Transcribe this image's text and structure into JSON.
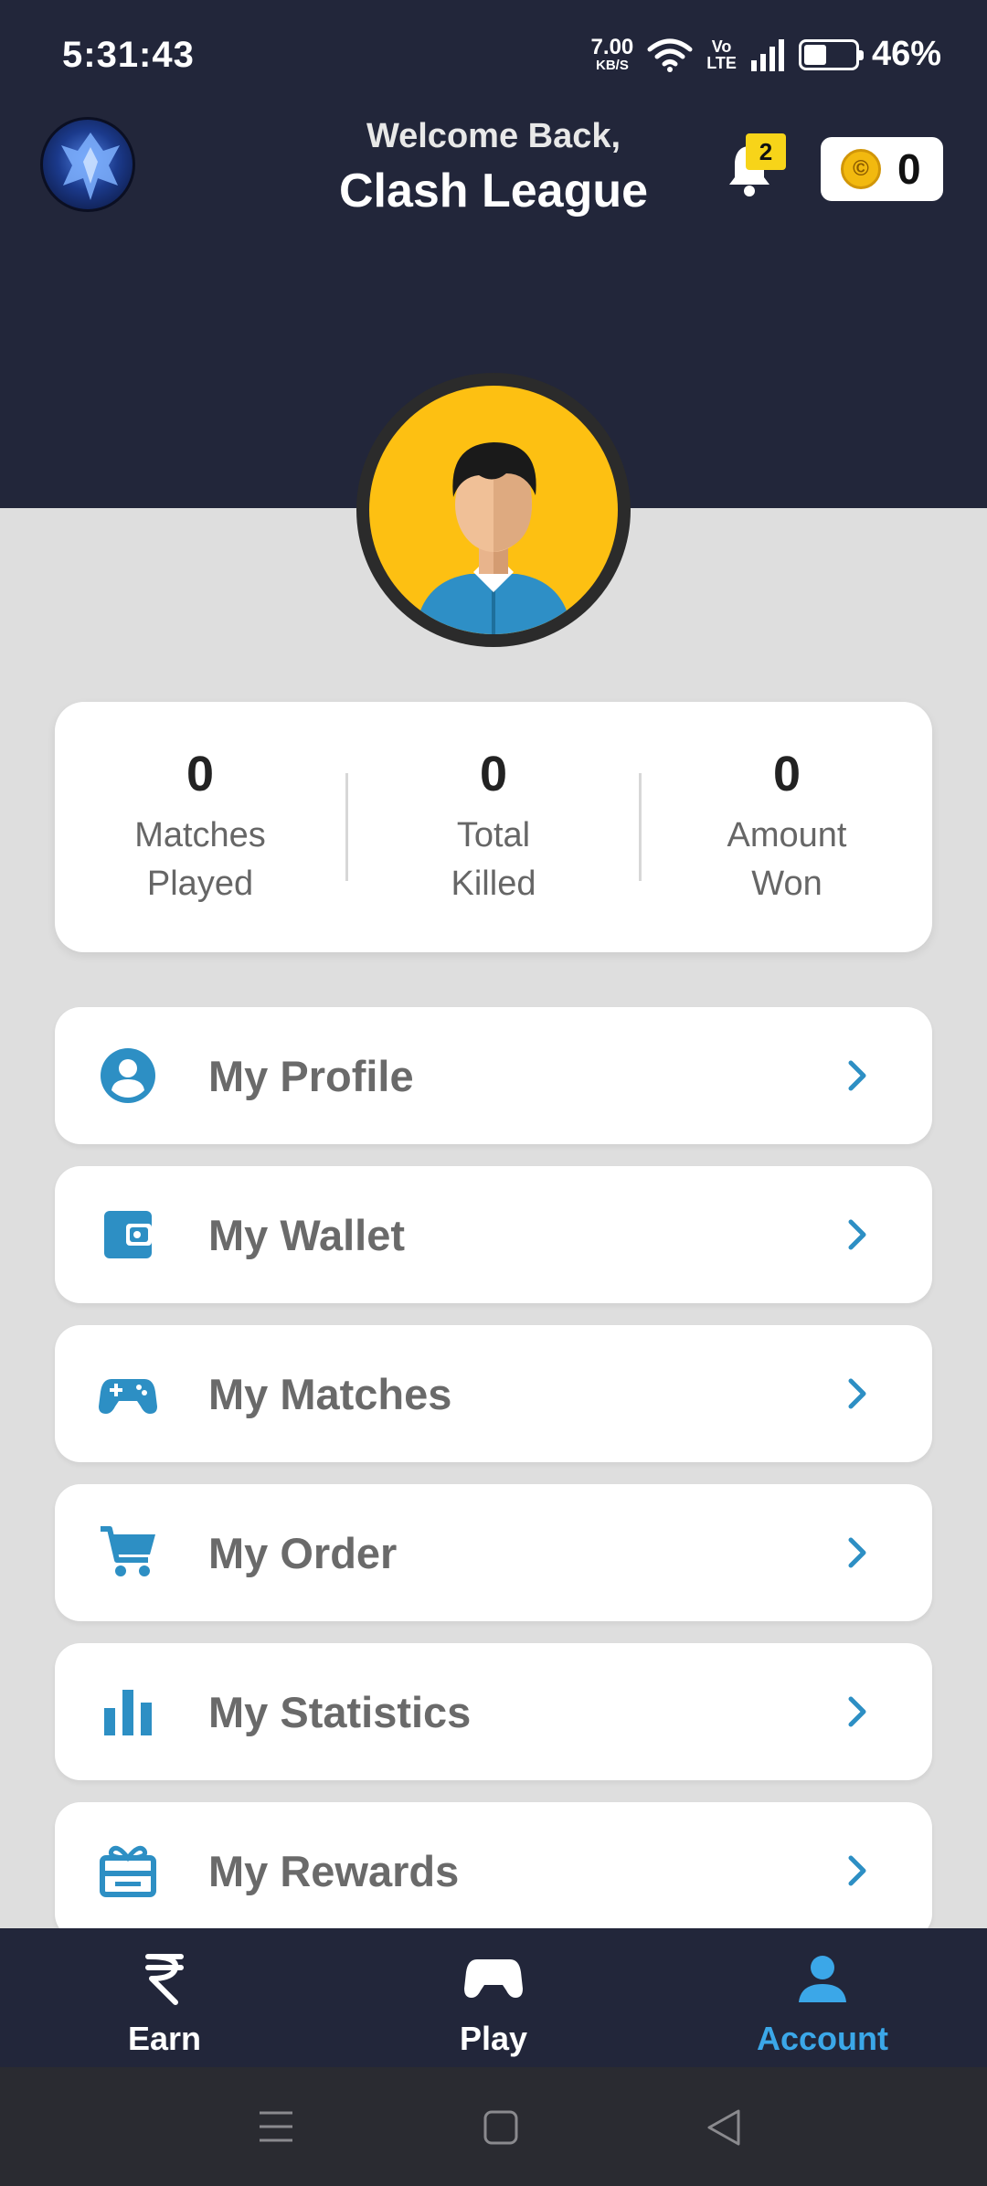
{
  "status_bar": {
    "time": "5:31:43",
    "net_speed_value": "7.00",
    "net_speed_unit": "KB/S",
    "volte_top": "Vo",
    "volte_bottom": "LTE",
    "battery_percent": "46%"
  },
  "header": {
    "welcome_text": "Welcome Back,",
    "app_name": "Clash League",
    "notification_count": "2",
    "coin_symbol": "©",
    "coin_balance": "0"
  },
  "stats": [
    {
      "value": "0",
      "label": "Matches\nPlayed"
    },
    {
      "value": "0",
      "label": "Total\nKilled"
    },
    {
      "value": "0",
      "label": "Amount\nWon"
    }
  ],
  "menu": [
    {
      "label": "My Profile",
      "icon": "profile-icon"
    },
    {
      "label": "My Wallet",
      "icon": "wallet-icon"
    },
    {
      "label": "My Matches",
      "icon": "gamepad-icon"
    },
    {
      "label": "My Order",
      "icon": "cart-icon"
    },
    {
      "label": "My Statistics",
      "icon": "bar-chart-icon"
    },
    {
      "label": "My Rewards",
      "icon": "gift-icon"
    }
  ],
  "bottom_nav": [
    {
      "label": "Earn",
      "icon": "rupee-icon",
      "active": false
    },
    {
      "label": "Play",
      "icon": "gamepad-icon",
      "active": false
    },
    {
      "label": "Account",
      "icon": "user-icon",
      "active": true
    }
  ],
  "colors": {
    "header_bg": "#22263a",
    "accent_blue": "#2d8fc4",
    "active_nav": "#3ba7e8",
    "badge_yellow": "#f7d419",
    "page_bg": "#dedede"
  }
}
